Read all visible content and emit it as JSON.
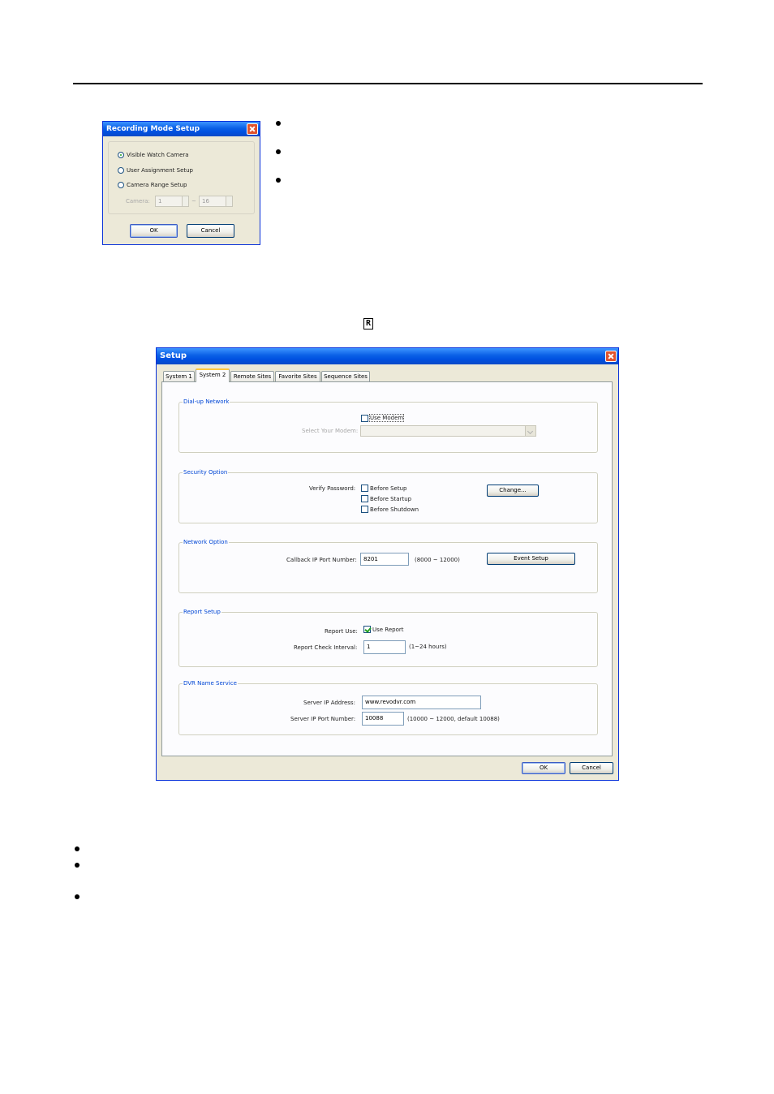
{
  "recording_mode_dialog": {
    "title": "Recording Mode Setup",
    "options": [
      "Visible Watch Camera",
      "User Assignment Setup",
      "Camera Range Setup"
    ],
    "selected": "Visible Watch Camera",
    "camera_label": "Camera:",
    "range_from": "1",
    "range_sep": "~",
    "range_to": "16",
    "ok_label": "OK",
    "cancel_label": "Cancel"
  },
  "toolbar_icon": {
    "glyph": "R"
  },
  "setup_dialog": {
    "title": "Setup",
    "tabs": [
      "System 1",
      "System 2",
      "Remote Sites",
      "Favorite Sites",
      "Sequence Sites"
    ],
    "active_tab": "System 2",
    "dialup": {
      "title": "Dial-up Network",
      "use_modem_label": "Use Modem",
      "use_modem_checked": false,
      "select_modem_label": "Select Your Modem:",
      "select_modem_value": ""
    },
    "security": {
      "title": "Security Option",
      "verify_label": "Verify Password:",
      "options": [
        {
          "label": "Before Setup",
          "checked": false
        },
        {
          "label": "Before Startup",
          "checked": false
        },
        {
          "label": "Before Shutdown",
          "checked": false
        }
      ],
      "change_label": "Change..."
    },
    "network": {
      "title": "Network Option",
      "callback_label": "Callback IP Port Number:",
      "callback_value": "8201",
      "callback_range": "(8000 ~ 12000)",
      "event_setup_label": "Event Setup"
    },
    "report": {
      "title": "Report Setup",
      "report_use_label": "Report Use:",
      "use_report_label": "Use Report",
      "use_report_checked": true,
      "interval_label": "Report Check Interval:",
      "interval_value": "1",
      "interval_range": "(1~24 hours)"
    },
    "dvrns": {
      "title": "DVR Name Service",
      "server_ip_label": "Server IP Address:",
      "server_ip_value": "www.revodvr.com",
      "server_port_label": "Server IP Port Number:",
      "server_port_value": "10088",
      "server_port_range": "(10000 ~ 12000, default 10088)"
    },
    "ok_label": "OK",
    "cancel_label": "Cancel"
  }
}
